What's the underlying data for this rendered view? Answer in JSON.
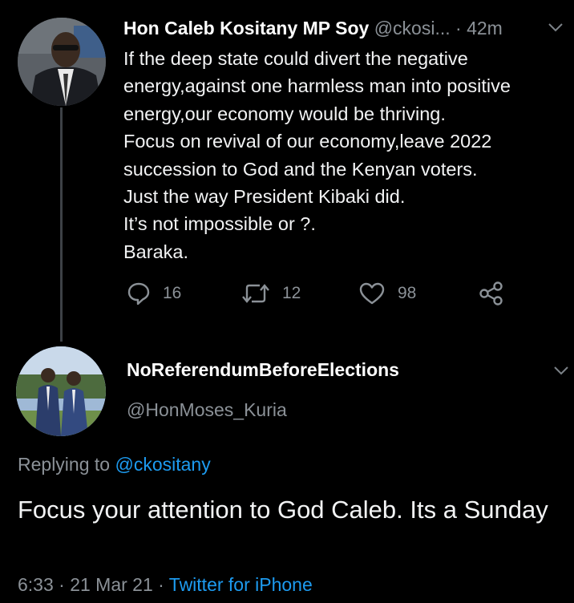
{
  "parent_tweet": {
    "display_name": "Hon Caleb Kositany MP Soy",
    "handle": "@ckosi...",
    "time": "· 42m",
    "text_lines": [
      "If the deep state could divert the negative",
      "energy,against one harmless man into positive",
      "energy,our economy would be thriving.",
      "Focus on revival of our economy,leave 2022",
      "succession to God and the Kenyan voters.",
      "Just the way President Kibaki did.",
      "It’s not impossible or ?.",
      "Baraka."
    ],
    "actions": {
      "reply_count": "16",
      "retweet_count": "12",
      "like_count": "98"
    }
  },
  "reply_tweet": {
    "display_name": "NoReferendumBeforeElections",
    "handle": "@HonMoses_Kuria",
    "replying_prefix": "Replying to",
    "replying_to": "@ckositany",
    "text": "Focus your attention to God Caleb. Its a Sunday",
    "time": "6:33 · 21 Mar 21 · ",
    "source": "Twitter for iPhone"
  },
  "colors": {
    "background": "#000000",
    "text": "#f2f3f4",
    "secondary": "#8b9197",
    "link": "#1d9bf0"
  },
  "icons": [
    "chevron-down-icon",
    "reply-icon",
    "retweet-icon",
    "like-icon",
    "share-icon"
  ]
}
